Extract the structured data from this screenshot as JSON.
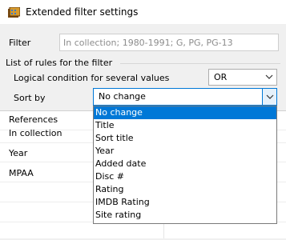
{
  "window": {
    "title": "Extended filter settings",
    "app_icon": "filter-app-icon"
  },
  "filter": {
    "label": "Filter",
    "value": "In collection; 1980-1991; G, PG, PG-13"
  },
  "rules": {
    "group_label": "List of rules for the filter",
    "logical_label": "Logical condition for several values",
    "logical_value": "OR",
    "sort_label": "Sort by",
    "sort_value": "No change"
  },
  "references": {
    "header": "References",
    "rows": [
      "In collection",
      "Year",
      "MPAA"
    ]
  },
  "sort_options": [
    "No change",
    "Title",
    "Sort title",
    "Year",
    "Added date",
    "Disc #",
    "Rating",
    "IMDB Rating",
    "Site rating"
  ],
  "colors": {
    "selection": "#0078d7",
    "focus_border": "#0078d7"
  }
}
